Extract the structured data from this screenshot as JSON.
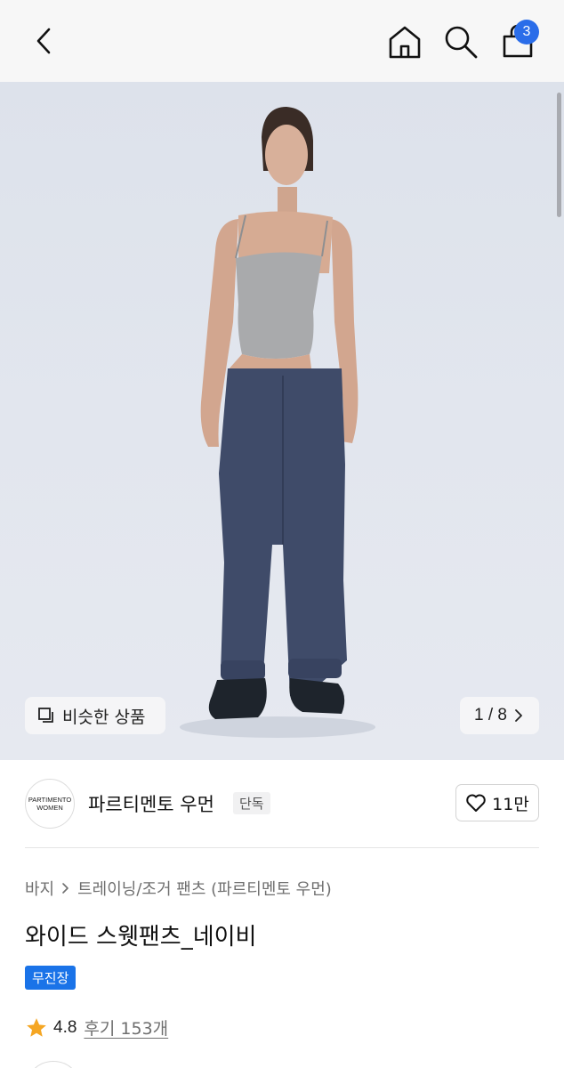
{
  "header": {
    "back_icon": "chevron-left-icon",
    "home_icon": "home-icon",
    "search_icon": "search-icon",
    "cart_icon": "shopping-bag-icon",
    "cart_count": "3",
    "accent_color": "#2a6de9"
  },
  "gallery": {
    "similar_label": "비슷한 상품",
    "counter": "1 / 8",
    "current_index": 1,
    "total_images": 8
  },
  "brand": {
    "logo_line1": "PARTIMENTO",
    "logo_line2": "WOMEN",
    "name": "파르티멘토 우먼",
    "tag": "단독",
    "likes": "11만"
  },
  "product": {
    "breadcrumb": [
      "바지",
      "트레이닝/조거 팬츠 (파르티멘토 우먼)"
    ],
    "title": "와이드 스웻팬츠_네이비",
    "badge": "무진장",
    "badge_color": "#1a73e8",
    "rating": "4.8",
    "reviews": "후기 153개",
    "star_color": "#f5a623"
  }
}
